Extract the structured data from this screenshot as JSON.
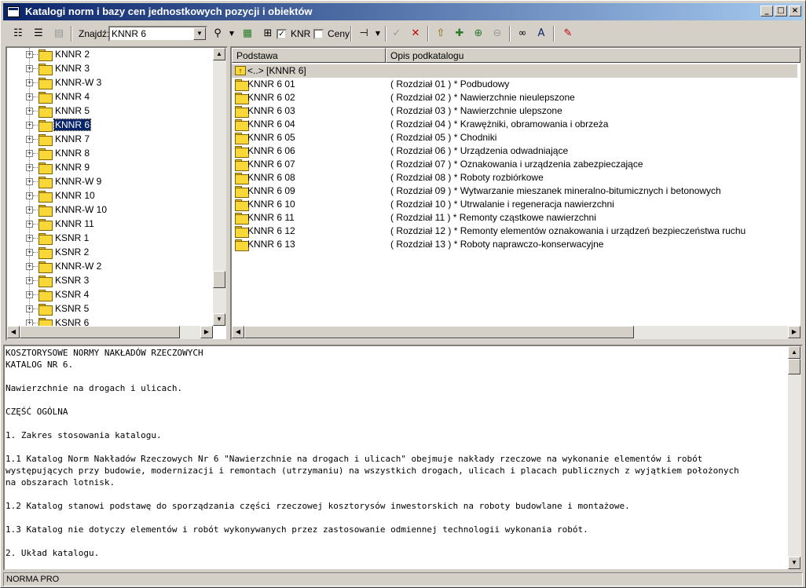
{
  "window": {
    "title": "Katalogi norm i bazy cen jednostkowych pozycji i obiektów",
    "minimize": "_",
    "maximize": "□",
    "close": "×"
  },
  "toolbar": {
    "find_label": "Znajdź:",
    "find_value": "KNNR 6",
    "knr_label": "KNR",
    "knr_checked": "✓",
    "ceny_label": "Ceny"
  },
  "tree": {
    "items": [
      {
        "label": "KNNR 2",
        "selected": false
      },
      {
        "label": "KNNR 3",
        "selected": false
      },
      {
        "label": "KNNR-W 3",
        "selected": false
      },
      {
        "label": "KNNR 4",
        "selected": false
      },
      {
        "label": "KNNR 5",
        "selected": false
      },
      {
        "label": "KNNR 6",
        "selected": true
      },
      {
        "label": "KNNR 7",
        "selected": false
      },
      {
        "label": "KNNR 8",
        "selected": false
      },
      {
        "label": "KNNR 9",
        "selected": false
      },
      {
        "label": "KNNR-W 9",
        "selected": false
      },
      {
        "label": "KNNR 10",
        "selected": false
      },
      {
        "label": "KNNR-W 10",
        "selected": false
      },
      {
        "label": "KNNR 11",
        "selected": false
      },
      {
        "label": "KSNR 1",
        "selected": false
      },
      {
        "label": "KSNR 2",
        "selected": false
      },
      {
        "label": "KNNR-W 2",
        "selected": false
      },
      {
        "label": "KSNR 3",
        "selected": false
      },
      {
        "label": "KSNR 4",
        "selected": false
      },
      {
        "label": "KSNR 5",
        "selected": false
      },
      {
        "label": "KSNR 6",
        "selected": false
      }
    ]
  },
  "list": {
    "columns": [
      "Podstawa",
      "Opis podkatalogu"
    ],
    "up_row": "<..> [KNNR 6]",
    "rows": [
      {
        "podstawa": "KNNR 6 01",
        "opis": "( Rozdział 01 ) * Podbudowy"
      },
      {
        "podstawa": "KNNR 6 02",
        "opis": "( Rozdział 02 ) * Nawierzchnie nieulepszone"
      },
      {
        "podstawa": "KNNR 6 03",
        "opis": "( Rozdział 03 ) * Nawierzchnie ulepszone"
      },
      {
        "podstawa": "KNNR 6 04",
        "opis": "( Rozdział 04 ) * Krawężniki, obramowania i obrzeża"
      },
      {
        "podstawa": "KNNR 6 05",
        "opis": "( Rozdział 05 ) * Chodniki"
      },
      {
        "podstawa": "KNNR 6 06",
        "opis": "( Rozdział 06 ) * Urządzenia odwadniające"
      },
      {
        "podstawa": "KNNR 6 07",
        "opis": "( Rozdział 07 ) * Oznakowania i urządzenia zabezpieczające"
      },
      {
        "podstawa": "KNNR 6 08",
        "opis": "( Rozdział 08 ) * Roboty rozbiórkowe"
      },
      {
        "podstawa": "KNNR 6 09",
        "opis": "( Rozdział 09 ) * Wytwarzanie mieszanek mineralno-bitumicznych i betonowych"
      },
      {
        "podstawa": "KNNR 6 10",
        "opis": "( Rozdział 10 ) * Utrwalanie i regeneracja nawierzchni"
      },
      {
        "podstawa": "KNNR 6 11",
        "opis": "( Rozdział 11 ) * Remonty cząstkowe nawierzchni"
      },
      {
        "podstawa": "KNNR 6 12",
        "opis": "( Rozdział 12 ) * Remonty elementów oznakowania i urządzeń bezpieczeństwa ruchu"
      },
      {
        "podstawa": "KNNR 6 13",
        "opis": "( Rozdział 13 ) * Roboty naprawczo-konserwacyjne"
      }
    ]
  },
  "description": {
    "lines": [
      "KOSZTORYSOWE NORMY NAKŁADÓW RZECZOWYCH",
      "KATALOG NR 6.",
      "",
      "Nawierzchnie na drogach i ulicach.",
      "",
      "CZĘŚĆ OGÓLNA",
      "",
      "1. Zakres stosowania katalogu.",
      "",
      "1.1 Katalog Norm Nakładów Rzeczowych Nr 6 \"Nawierzchnie na drogach i ulicach\" obejmuje nakłady rzeczowe na wykonanie elementów i robót",
      "występujących przy budowie, modernizacji i remontach (utrzymaniu) na wszystkich drogach, ulicach i placach publicznych z wyjątkiem położonych",
      "na obszarach lotnisk.",
      "",
      "1.2 Katalog stanowi podstawę do sporządzania części rzeczowej kosztorysów inwestorskich na roboty budowlane i montażowe.",
      "",
      "1.3 Katalog nie dotyczy elementów i robót wykonywanych przez zastosowanie odmiennej technologii wykonania robót.",
      "",
      "2. Układ katalogu."
    ]
  },
  "status": {
    "text": "NORMA PRO"
  }
}
